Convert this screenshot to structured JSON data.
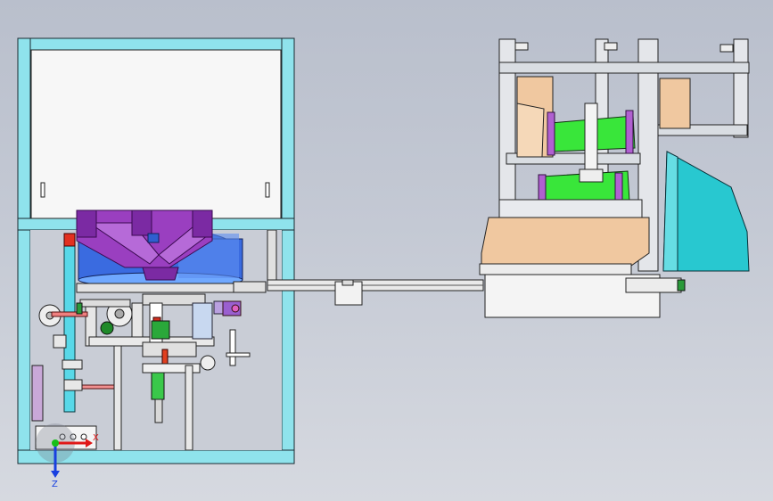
{
  "view": {
    "background_top": "#b9bfcc",
    "background_bottom": "#d6d9e0"
  },
  "colors": {
    "frame_cyan": "#8fe3ec",
    "panel_white": "#f6f6f6",
    "hopper_purple": "#9a3fc0",
    "bowl_blue": "#2f5fd0",
    "belt_green": "#39e63a",
    "wood_tan": "#f0c8a0",
    "chute_teal": "#28c8d0",
    "aluminum": "#d9dde2",
    "axis_red": "#e01818",
    "axis_green": "#18c018",
    "axis_blue": "#1840e0"
  },
  "triad": {
    "x_label": "X",
    "z_label": "Z",
    "icon": "coordinate-triad-icon"
  },
  "machine": {
    "left_unit": "feeder-station",
    "conveyor": "linear-conveyor",
    "right_unit": "boxing-station"
  }
}
